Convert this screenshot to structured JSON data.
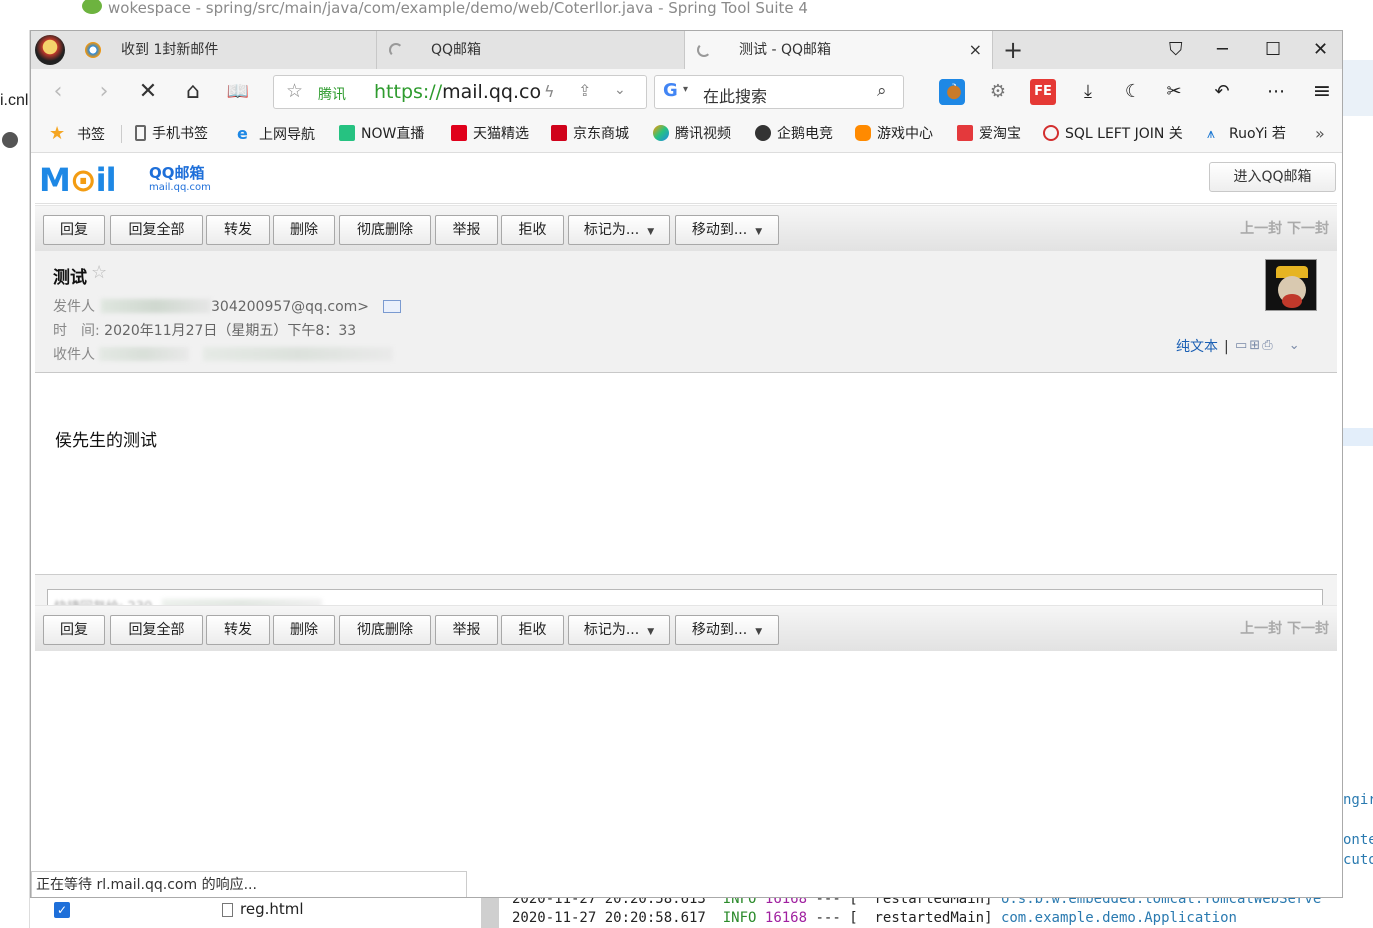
{
  "ide": {
    "title": "wokespace - spring/src/main/java/com/example/demo/web/Coterllor.java - Spring Tool Suite 4",
    "left_fragment": "i.cnl",
    "right_fragments": [
      "ngir",
      "onte",
      "cuto"
    ],
    "tree_file": "reg.html",
    "console_lines": [
      {
        "time": "2020-11-27 20:20:58.613",
        "level": "INFO",
        "pid": "16168",
        "sep": "--- [",
        "thread": "restartedMain]",
        "logger": "o.s.b.w.embedded.tomcat.TomcatWebServe"
      },
      {
        "time": "2020-11-27 20:20:58.617",
        "level": "INFO",
        "pid": "16168",
        "sep": "--- [",
        "thread": "restartedMain]",
        "logger": "com.example.demo.Application"
      }
    ]
  },
  "browser": {
    "tabs": [
      {
        "label": "收到 1封新邮件",
        "icon": "qq-mail-icon"
      },
      {
        "label": "QQ邮箱",
        "icon": "loading-icon"
      },
      {
        "label": "测试 - QQ邮箱",
        "icon": "loading-icon",
        "close": "×"
      }
    ],
    "new_tab": "+",
    "window_controls": {
      "minimize": "─",
      "maximize": "☐",
      "close": "✕"
    },
    "url": {
      "site": "腾讯",
      "scheme": "https://",
      "host": "mail.qq.co"
    },
    "search_placeholder": "在此搜索",
    "bookmarks": [
      {
        "label": "书签",
        "icon": "star-icon",
        "color": "#f5a623"
      },
      {
        "label": "手机书签",
        "icon": "phone-icon",
        "color": "#666666"
      },
      {
        "label": "上网导航",
        "icon": "ie-icon",
        "color": "#1e88e5"
      },
      {
        "label": "NOW直播",
        "icon": "now-icon",
        "color": "#26c281"
      },
      {
        "label": "天猫精选",
        "icon": "tmall-icon",
        "color": "#e0001b"
      },
      {
        "label": "京东商城",
        "icon": "jd-icon",
        "color": "#d0021b"
      },
      {
        "label": "腾讯视频",
        "icon": "tencent-video-icon",
        "color": "#ff9800"
      },
      {
        "label": "企鹅电竞",
        "icon": "penguin-esports-icon",
        "color": "#333333"
      },
      {
        "label": "游戏中心",
        "icon": "gamepad-icon",
        "color": "#ff8a00"
      },
      {
        "label": "爱淘宝",
        "icon": "taobao-icon",
        "color": "#e4393c"
      },
      {
        "label": "SQL LEFT JOIN 关",
        "icon": "sql-icon",
        "color": "#d32f2f"
      },
      {
        "label": "RuoYi 若",
        "icon": "ruoyi-icon",
        "color": "#1976d2"
      }
    ],
    "bookmarks_more": "»",
    "status_text": "正在等待 rl.mail.qq.com 的响应..."
  },
  "mail": {
    "logo_text": "QQ邮箱",
    "logo_sub": "mail.qq.com",
    "enter_button": "进入QQ邮箱",
    "toolbar": {
      "reply": "回复",
      "reply_all": "回复全部",
      "forward": "转发",
      "delete": "删除",
      "delete_permanent": "彻底删除",
      "report": "举报",
      "reject": "拒收",
      "mark_as": "标记为...",
      "move_to": "移动到...",
      "prev": "上一封",
      "next": "下一封"
    },
    "subject": "测试",
    "from_label": "发件人",
    "from_value": "304200957@qq.com>",
    "time_label": "时　间:",
    "time_value": "2020年11月27日（星期五）下午8：33",
    "to_label": "收件人",
    "plain_text_link": "纯文本",
    "body": "侯先生的测试",
    "quick_reply_placeholder": "快捷回复给: 230"
  }
}
